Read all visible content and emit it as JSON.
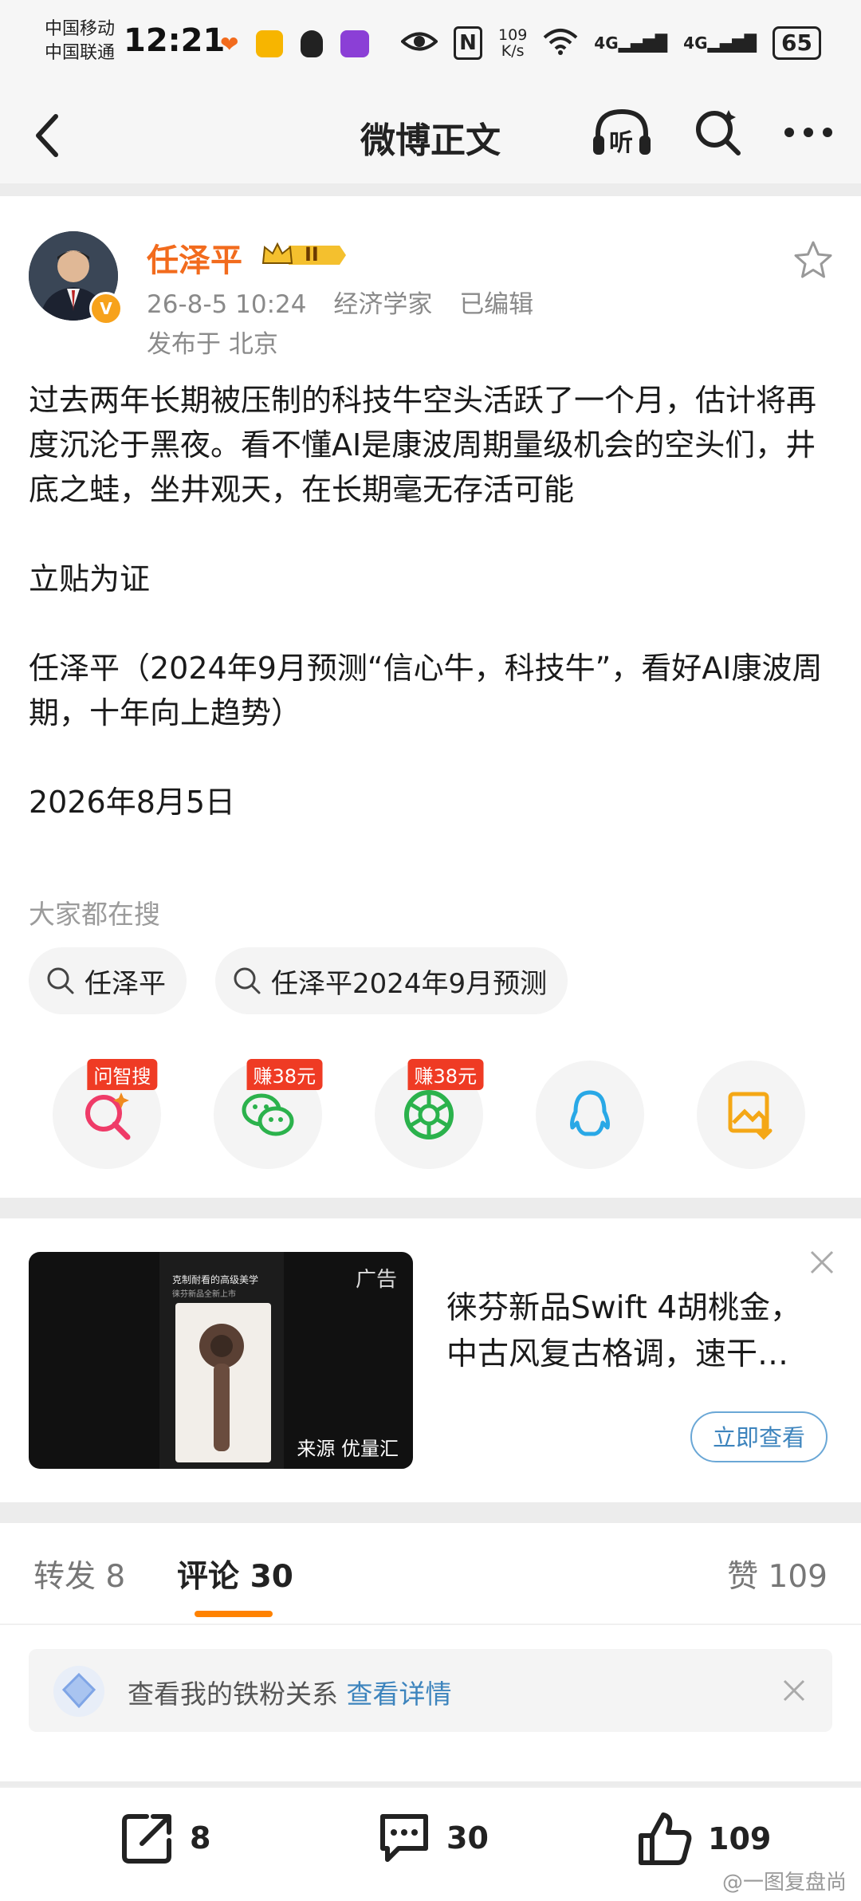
{
  "status_bar": {
    "carrier_1": "中国移动",
    "carrier_2": "中国联通",
    "time": "12:21",
    "net_speed": "109",
    "net_speed_unit": "K/s",
    "signal_1": "4G",
    "signal_2": "4G",
    "battery": "65"
  },
  "nav": {
    "title": "微博正文",
    "listen_label": "听"
  },
  "post": {
    "author": "任泽平",
    "level_badge": "II",
    "time": "26-8-5 10:24",
    "source": "经济学家",
    "edited": "已编辑",
    "location": "发布于 北京",
    "body": "过去两年长期被压制的科技牛空头活跃了一个月，估计将再度沉沦于黑夜。看不懂AI是康波周期量级机会的空头们，井底之蛙，坐井观天，在长期毫无存活可能\n\n立贴为证\n\n任泽平（2024年9月预测“信心牛，科技牛”，看好AI康波周期，十年向上趋势）\n\n2026年8月5日"
  },
  "search": {
    "hint": "大家都在搜",
    "chips": [
      "任泽平",
      "任泽平2024年9月预测"
    ]
  },
  "share": [
    {
      "tag": "问智搜",
      "icon": "ai-search-icon"
    },
    {
      "tag": "赚38元",
      "icon": "wechat-icon"
    },
    {
      "tag": "赚38元",
      "icon": "moments-icon"
    },
    {
      "tag": "",
      "icon": "qq-icon"
    },
    {
      "tag": "",
      "icon": "save-image-icon"
    }
  ],
  "ad": {
    "label": "广告",
    "image_caption": "来源 优量汇",
    "image_headline": "克制耐看的高级美学",
    "image_subline": "徕芬新品全新上市",
    "text": "徕芬新品Swift 4胡桃金，中古风复古格调，速干…",
    "button": "立即查看"
  },
  "tabs": {
    "repost": "转发",
    "repost_count": "8",
    "comment": "评论",
    "comment_count": "30",
    "like": "赞",
    "like_count": "109"
  },
  "fans": {
    "text": "查看我的铁粉关系",
    "link": "查看详情"
  },
  "bottom_bar": {
    "repost_count": "8",
    "comment_count": "30",
    "like_count": "109"
  },
  "watermark": "@一图复盘尚",
  "colors": {
    "username": "#f26b1d",
    "tab_indicator": "#ff8200",
    "link": "#3d84bd",
    "tag": "#ef3b24"
  }
}
